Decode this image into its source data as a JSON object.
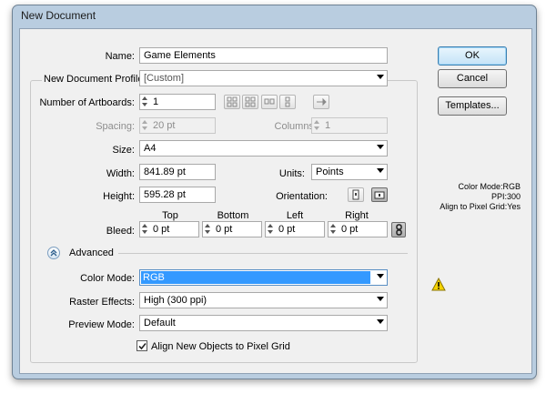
{
  "dialog": {
    "title": "New Document"
  },
  "name": {
    "label": "Name:",
    "value": "Game Elements"
  },
  "profile": {
    "label": "New Document Profile:",
    "value": "[Custom]"
  },
  "artboards": {
    "label": "Number of Artboards:",
    "value": "1"
  },
  "spacing": {
    "label": "Spacing:",
    "value": "20 pt"
  },
  "columns": {
    "label": "Columns:",
    "value": "1"
  },
  "size": {
    "label": "Size:",
    "value": "A4"
  },
  "width": {
    "label": "Width:",
    "value": "841.89 pt"
  },
  "units": {
    "label": "Units:",
    "value": "Points"
  },
  "height": {
    "label": "Height:",
    "value": "595.28 pt"
  },
  "orientation": {
    "label": "Orientation:",
    "selected": "landscape"
  },
  "bleed": {
    "label": "Bleed:",
    "headers": {
      "top": "Top",
      "bottom": "Bottom",
      "left": "Left",
      "right": "Right"
    },
    "values": {
      "top": "0 pt",
      "bottom": "0 pt",
      "left": "0 pt",
      "right": "0 pt"
    },
    "linked": true
  },
  "advanced": {
    "label": "Advanced"
  },
  "color_mode": {
    "label": "Color Mode:",
    "value": "RGB"
  },
  "raster_effects": {
    "label": "Raster Effects:",
    "value": "High (300 ppi)"
  },
  "preview_mode": {
    "label": "Preview Mode:",
    "value": "Default"
  },
  "align_pixel": {
    "label": "Align New Objects to Pixel Grid",
    "checked": true
  },
  "buttons": {
    "ok": "OK",
    "cancel": "Cancel",
    "templates": "Templates..."
  },
  "summary": {
    "line1": "Color Mode:RGB",
    "line2": "PPI:300",
    "line3": "Align to Pixel Grid:Yes"
  },
  "icons": {
    "warning": "warning-icon",
    "advanced_toggle": "collapse-chevron-icon",
    "portrait": "portrait-icon",
    "landscape": "landscape-icon",
    "chain": "chain-link-icon"
  }
}
